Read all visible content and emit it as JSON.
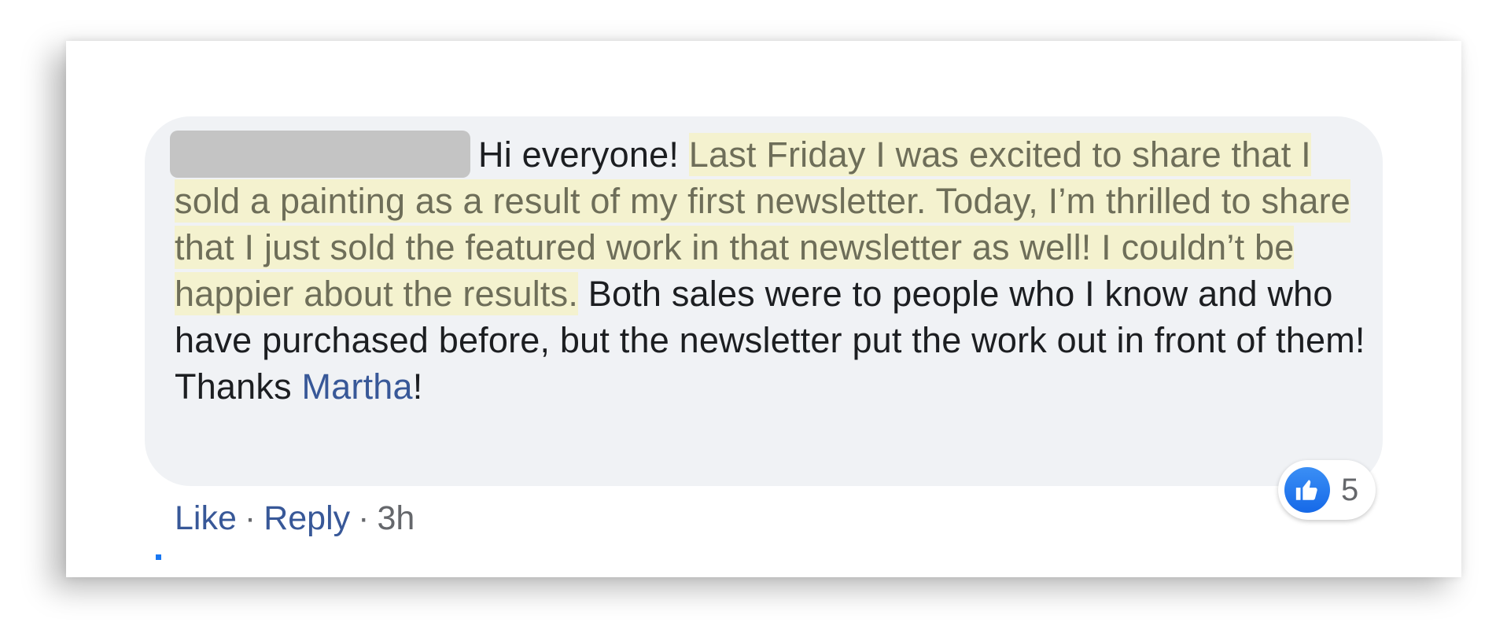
{
  "comment": {
    "greeting": "Hi everyone! ",
    "highlighted": "Last Friday I was excited to share that I sold a painting as a result of my first newsletter. Today, I’m thrilled to share that I just sold the featured work in that newsletter as well! I couldn’t be happier about the results.",
    "continued": " Both sales were to people who I know and who have purchased before, but the newsletter put the work out in front of them! Thanks ",
    "mention": "Martha",
    "ending": "!"
  },
  "reactions": {
    "icon": "thumbs-up-icon",
    "count": "5",
    "color": "#1877f2"
  },
  "actions": {
    "like": "Like",
    "reply": "Reply",
    "separator": "·",
    "time": "3h"
  },
  "colors": {
    "bubble": "#f0f2f5",
    "highlight": "#f4f2cf",
    "link": "#385898"
  }
}
